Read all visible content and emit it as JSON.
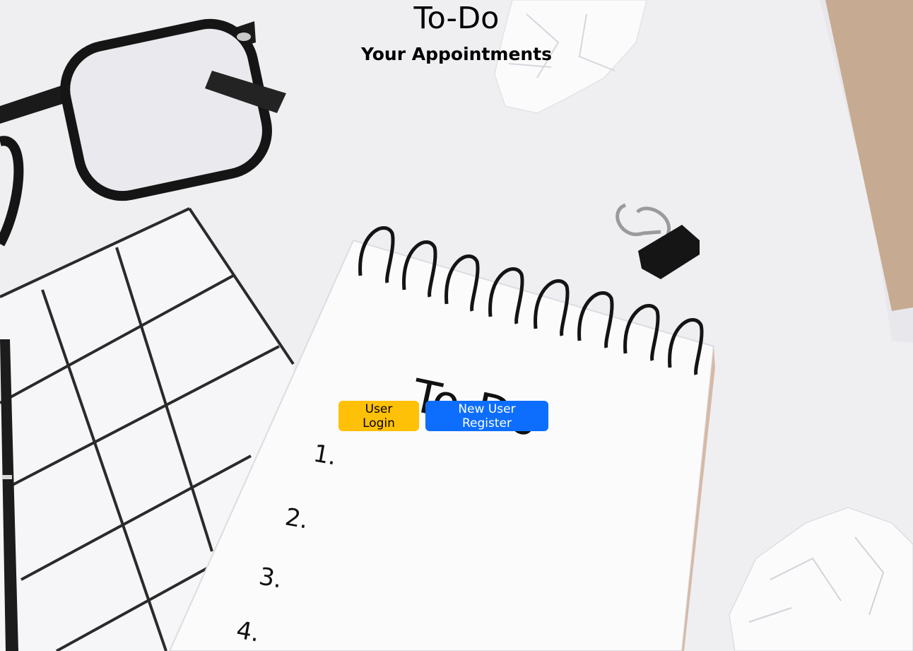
{
  "header": {
    "title": "To-Do",
    "subtitle": "Your Appointments"
  },
  "actions": {
    "login_label": "User Login",
    "register_label": "New User Register"
  },
  "background": {
    "handwriting": {
      "heading": "To-Do",
      "items": [
        "1.",
        "2.",
        "3.",
        "4."
      ]
    }
  },
  "colors": {
    "login": "#ffc107",
    "register": "#0d6efd"
  }
}
